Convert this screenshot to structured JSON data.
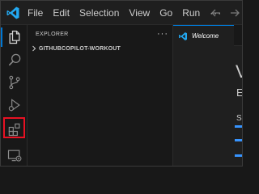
{
  "menu": {
    "items": [
      "File",
      "Edit",
      "Selection",
      "View",
      "Go",
      "Run"
    ],
    "more": "···"
  },
  "colors": {
    "accent": "#0078d4",
    "highlight": "#e81123",
    "logo": "#23a9f2"
  },
  "activity_bar": {
    "items": [
      {
        "icon": "files-icon",
        "active": true
      },
      {
        "icon": "search-icon",
        "active": false
      },
      {
        "icon": "source-control-icon",
        "active": false
      },
      {
        "icon": "run-debug-icon",
        "active": false
      },
      {
        "icon": "extensions-icon",
        "active": false,
        "highlighted": true
      },
      {
        "icon": "remote-explorer-icon",
        "active": false
      }
    ]
  },
  "sidebar": {
    "title": "EXPLORER",
    "more": "···",
    "folder": "GITHUBCOPILOT-WORKOUT"
  },
  "editor": {
    "tab_label": "Welcome",
    "heading_fragment": "V",
    "subheading_fragment": "E",
    "section_fragment": "S"
  }
}
